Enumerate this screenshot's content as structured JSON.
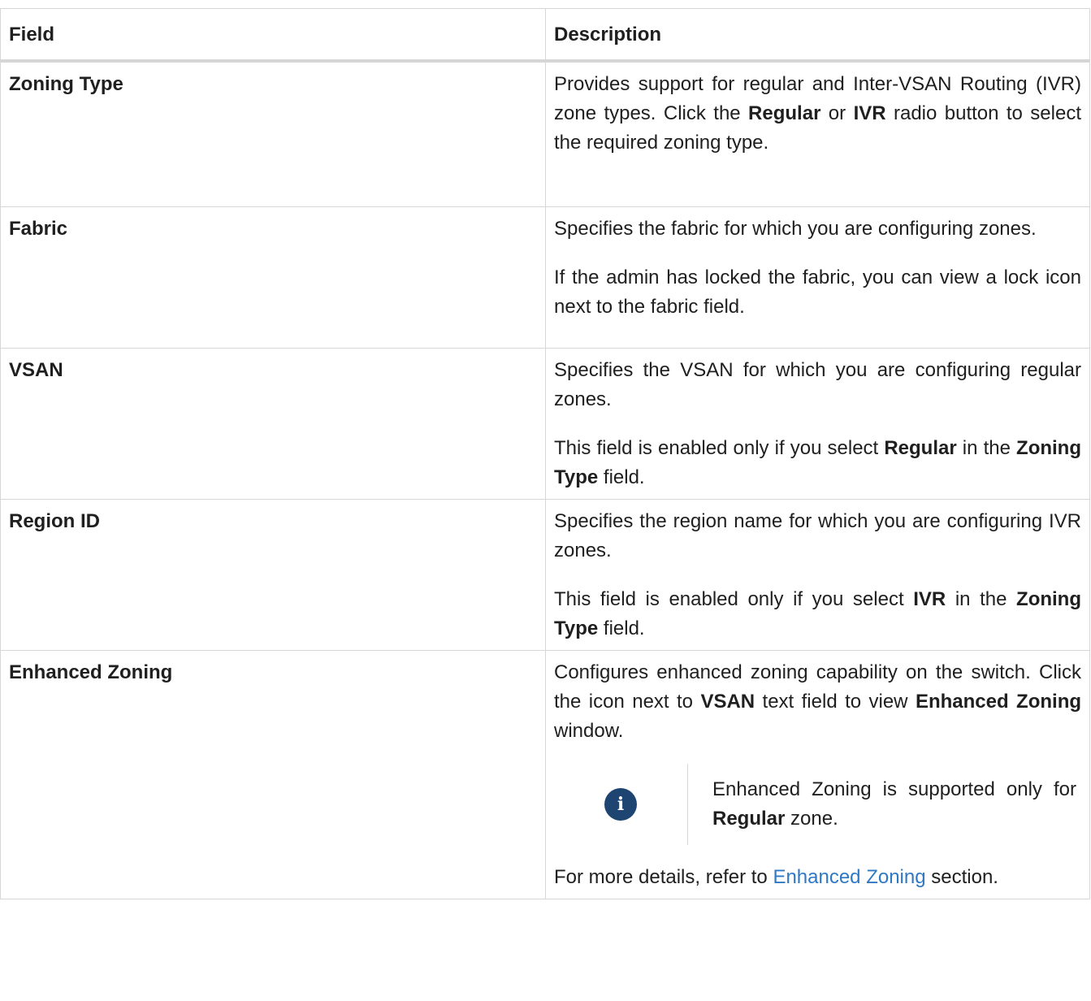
{
  "table": {
    "headers": {
      "field": "Field",
      "description": "Description"
    },
    "rows": [
      {
        "field": "Zoning Type",
        "description": {
          "t1": "Provides support for regular and Inter-VSAN Routing (IVR) zone types. Click the ",
          "b1": "Regular",
          "t2": " or ",
          "b2": "IVR",
          "t3": " radio button to select the required zoning type."
        }
      },
      {
        "field": "Fabric",
        "description": {
          "p1": "Specifies the fabric for which you are configuring zones.",
          "p2": "If the admin has locked the fabric, you can view a lock icon next to the fabric field."
        }
      },
      {
        "field": "VSAN",
        "description": {
          "p1": "Specifies the VSAN for which you are configuring regular zones.",
          "p2_t1": "This field is enabled only if you select ",
          "p2_b1": "Regular",
          "p2_t2": " in the ",
          "p2_b2": "Zoning Type",
          "p2_t3": " field."
        }
      },
      {
        "field": "Region ID",
        "description": {
          "p1": "Specifies the region name for which you are configuring IVR zones.",
          "p2_t1": "This field is enabled only if you select ",
          "p2_b1": "IVR",
          "p2_t2": " in the ",
          "p2_b2": "Zoning Type",
          "p2_t3": " field."
        }
      },
      {
        "field": "Enhanced Zoning",
        "description": {
          "p1_t1": "Configures enhanced zoning capability on the switch. Click the icon next to ",
          "p1_b1": "VSAN",
          "p1_t2": " text field to view ",
          "p1_b2": "Enhanced Zoning",
          "p1_t3": " window.",
          "note": {
            "icon": "info-icon",
            "glyph": "i",
            "t1": "Enhanced Zoning is supported only for ",
            "b1": "Regular",
            "t2": " zone."
          },
          "p2_t1": "For more details, refer to ",
          "p2_link": "Enhanced Zoning",
          "p2_t2": " section."
        }
      }
    ]
  },
  "colors": {
    "border": "#d6d6d6",
    "note_icon_bg": "#1e4471",
    "link": "#2f78c4",
    "text": "#1f1f1f"
  }
}
